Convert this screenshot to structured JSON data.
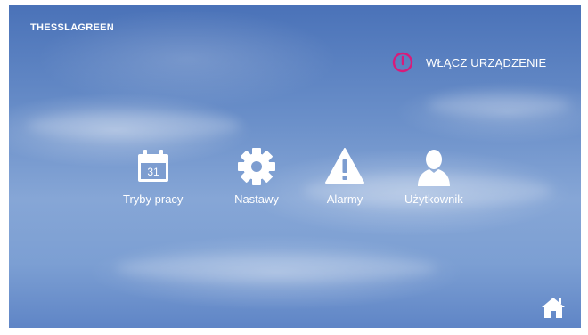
{
  "brand": "THESSLAGREEN",
  "power": {
    "label": "WŁĄCZ URZĄDZENIE",
    "icon": "power-icon",
    "icon_color": "#d81b7a"
  },
  "menu": [
    {
      "label": "Tryby pracy",
      "icon": "calendar-icon",
      "day": "31"
    },
    {
      "label": "Nastawy",
      "icon": "gear-icon"
    },
    {
      "label": "Alarmy",
      "icon": "warning-icon"
    },
    {
      "label": "Użytkownik",
      "icon": "user-icon"
    }
  ],
  "home": {
    "icon": "home-icon"
  },
  "colors": {
    "sky_top": "#4a72b8",
    "sky_mid": "#86a6d6",
    "text": "#ffffff",
    "accent": "#d81b7a"
  }
}
